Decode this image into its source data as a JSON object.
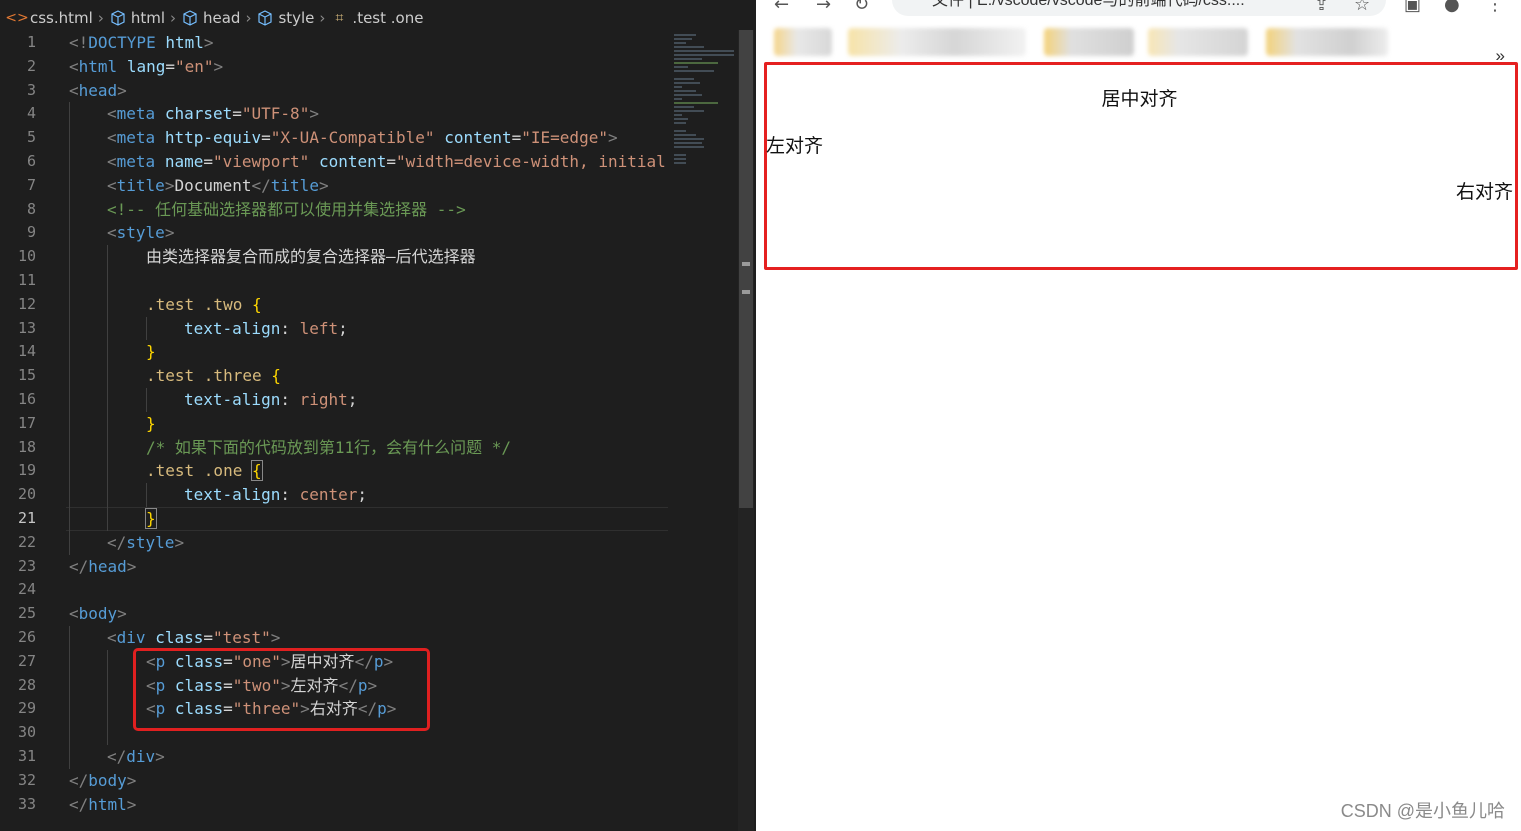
{
  "editor": {
    "breadcrumb": {
      "file": "css.html",
      "items": [
        "html",
        "head",
        "style",
        ".test .one"
      ]
    },
    "lines": [
      {
        "n": "1"
      },
      {
        "n": "2"
      },
      {
        "n": "3"
      },
      {
        "n": "4"
      },
      {
        "n": "5"
      },
      {
        "n": "6"
      },
      {
        "n": "7"
      },
      {
        "n": "8"
      },
      {
        "n": "9"
      },
      {
        "n": "10"
      },
      {
        "n": "11"
      },
      {
        "n": "12"
      },
      {
        "n": "13"
      },
      {
        "n": "14"
      },
      {
        "n": "15"
      },
      {
        "n": "16"
      },
      {
        "n": "17"
      },
      {
        "n": "18"
      },
      {
        "n": "19"
      },
      {
        "n": "20"
      },
      {
        "n": "21"
      },
      {
        "n": "22"
      },
      {
        "n": "23"
      },
      {
        "n": "24"
      },
      {
        "n": "25"
      },
      {
        "n": "26"
      },
      {
        "n": "27"
      },
      {
        "n": "28"
      },
      {
        "n": "29"
      },
      {
        "n": "30"
      },
      {
        "n": "31"
      },
      {
        "n": "32"
      },
      {
        "n": "33"
      }
    ],
    "code": {
      "l1_a": "<!",
      "l1_b": "DOCTYPE",
      "l1_c": " html",
      "l1_d": ">",
      "l2_tag": "html",
      "l2_attr": "lang",
      "l2_val": "\"en\"",
      "l3_tag": "head",
      "l4_tag": "meta",
      "l4_attr": "charset",
      "l4_val": "\"UTF-8\"",
      "l5_tag": "meta",
      "l5_attr1": "http-equiv",
      "l5_val1": "\"X-UA-Compatible\"",
      "l5_attr2": "content",
      "l5_val2": "\"IE=edge\"",
      "l6_tag": "meta",
      "l6_attr1": "name",
      "l6_val1": "\"viewport\"",
      "l6_attr2": "content",
      "l6_val2": "\"width=device-width, initial",
      "l7_tag": "title",
      "l7_text": "Document",
      "l8_comment": "<!-- 任何基础选择器都可以使用并集选择器 -->",
      "l9_tag": "style",
      "l10_text": "由类选择器复合而成的复合选择器—后代选择器",
      "l12_sel": ".test .two",
      "l13_prop": "text-align",
      "l13_val": "left",
      "l15_sel": ".test .three",
      "l16_prop": "text-align",
      "l16_val": "right",
      "l18_comment": "/* 如果下面的代码放到第11行，会有什么问题 */",
      "l19_sel": ".test .one",
      "l20_prop": "text-align",
      "l20_val": "center",
      "l22_tag": "style",
      "l23_tag": "head",
      "l25_tag": "body",
      "l26_tag": "div",
      "l26_attr": "class",
      "l26_val": "\"test\"",
      "l27_tag": "p",
      "l27_attr": "class",
      "l27_val": "\"one\"",
      "l27_text": "居中对齐",
      "l28_tag": "p",
      "l28_attr": "class",
      "l28_val": "\"two\"",
      "l28_text": "左对齐",
      "l29_tag": "p",
      "l29_attr": "class",
      "l29_val": "\"three\"",
      "l29_text": "右对齐",
      "l31_tag": "div",
      "l32_tag": "body",
      "l33_tag": "html",
      "open_brace": "{",
      "close_brace": "}",
      "semicolon": ";",
      "colon": ":"
    }
  },
  "browser": {
    "address": "文件 | E:/vscode/vscode与的前端代码/css....",
    "overflow": "»",
    "page": {
      "center_text": "居中对齐",
      "left_text": "左对齐",
      "right_text": "右对齐"
    },
    "watermark": "CSDN @是小鱼儿哈"
  },
  "colors": {
    "highlight_border": "#e02020",
    "editor_bg": "#1e1e1e"
  }
}
